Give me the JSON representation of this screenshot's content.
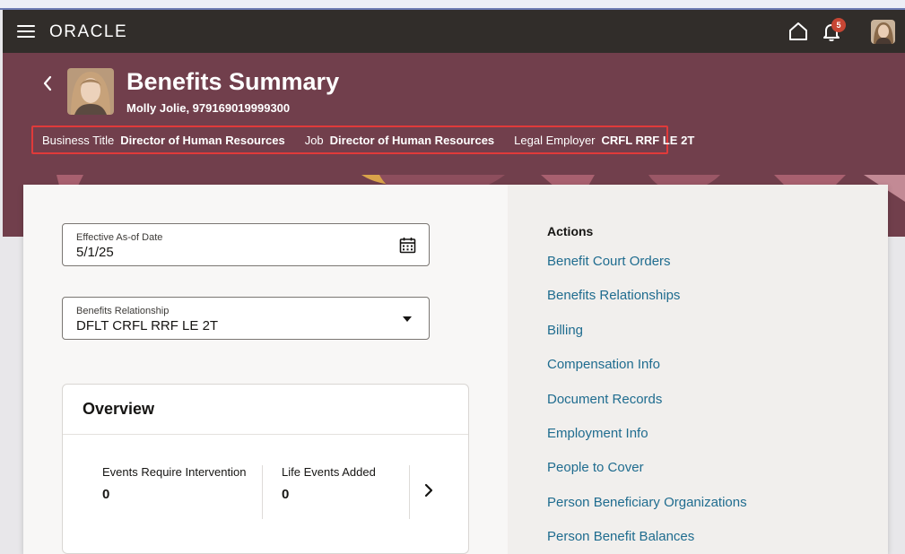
{
  "header": {
    "logo": "ORACLE",
    "notification_count": "5"
  },
  "hero": {
    "title": "Benefits Summary",
    "person": "Molly Jolie, 979169019999300",
    "info": [
      {
        "label": "Business Title",
        "value": "Director of Human Resources"
      },
      {
        "label": "Job",
        "value": "Director of Human Resources"
      },
      {
        "label": "Legal Employer",
        "value": "CRFL RRF LE 2T"
      }
    ]
  },
  "form": {
    "date_label": "Effective As-of Date",
    "date_value": "5/1/25",
    "relationship_label": "Benefits Relationship",
    "relationship_value": "DFLT CRFL RRF LE 2T"
  },
  "overview": {
    "title": "Overview",
    "metrics": [
      {
        "label": "Events Require Intervention",
        "value": "0"
      },
      {
        "label": "Life Events Added",
        "value": "0"
      }
    ]
  },
  "actions": {
    "title": "Actions",
    "items": [
      "Benefit Court Orders",
      "Benefits Relationships",
      "Billing",
      "Compensation Info",
      "Document Records",
      "Employment Info",
      "People to Cover",
      "Person Beneficiary Organizations",
      "Person Benefit Balances"
    ]
  },
  "colors": {
    "topbar": "#312d2a",
    "hero": "#713f4c",
    "link": "#1f6c8f",
    "badge": "#c74634",
    "highlight_border": "#e03a3a"
  }
}
